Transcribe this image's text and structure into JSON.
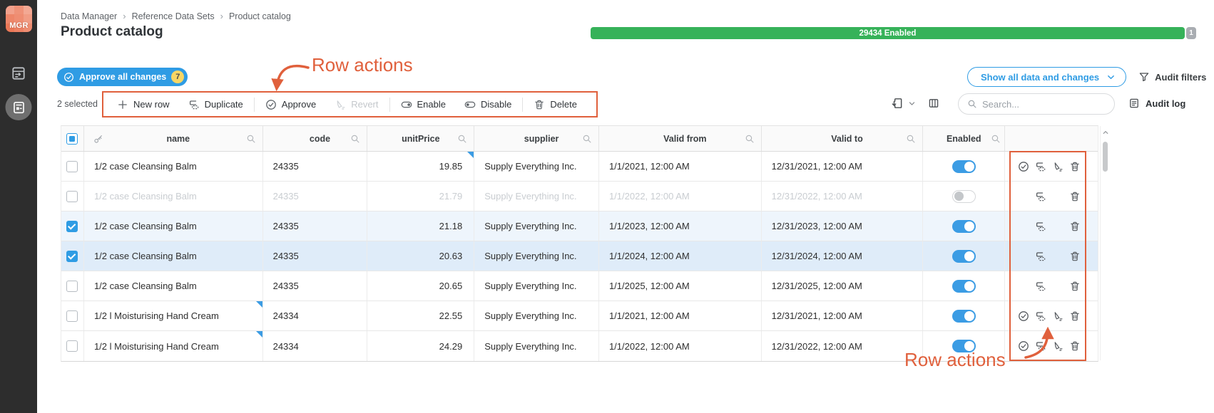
{
  "app": {
    "logo_text": "MGR"
  },
  "header": {
    "breadcrumb": [
      "Data Manager",
      "Reference Data Sets",
      "Product catalog"
    ],
    "title": "Product catalog",
    "status_bar": {
      "enabled_label": "29434 Enabled",
      "disabled_label": "1",
      "enabled_color": "#36b259"
    }
  },
  "actions_bar": {
    "approve_all_label": "Approve all changes",
    "approve_all_badge": "7",
    "show_all_label": "Show all data and changes",
    "audit_filters_label": "Audit filters"
  },
  "toolbar": {
    "selected_count": "2 selected",
    "new_row": "New row",
    "duplicate": "Duplicate",
    "approve": "Approve",
    "revert": "Revert",
    "enable": "Enable",
    "disable": "Disable",
    "delete": "Delete",
    "search_placeholder": "Search...",
    "audit_log_label": "Audit log"
  },
  "annotations": {
    "row_actions_top": "Row actions",
    "row_actions_bottom": "Row actions",
    "color": "#e0603c"
  },
  "table": {
    "columns": [
      "name",
      "code",
      "unitPrice",
      "supplier",
      "Valid from",
      "Valid to",
      "Enabled"
    ],
    "rows": [
      {
        "name": "1/2 case Cleansing Balm",
        "code": "24335",
        "unitPrice": "19.85",
        "supplier": "Supply Everything Inc.",
        "valid_from": "1/1/2021, 12:00 AM",
        "valid_to": "12/31/2021, 12:00 AM",
        "enabled": true,
        "state": "normal",
        "changed": "unitPrice",
        "actions": [
          "approve",
          "duplicate",
          "revert",
          "delete"
        ]
      },
      {
        "name": "1/2 case Cleansing Balm",
        "code": "24335",
        "unitPrice": "21.79",
        "supplier": "Supply Everything Inc.",
        "valid_from": "1/1/2022, 12:00 AM",
        "valid_to": "12/31/2022, 12:00 AM",
        "enabled": false,
        "state": "disabled",
        "changed": null,
        "actions": [
          "duplicate",
          "delete"
        ]
      },
      {
        "name": "1/2 case Cleansing Balm",
        "code": "24335",
        "unitPrice": "21.18",
        "supplier": "Supply Everything Inc.",
        "valid_from": "1/1/2023, 12:00 AM",
        "valid_to": "12/31/2023, 12:00 AM",
        "enabled": true,
        "state": "selected",
        "changed": null,
        "actions": [
          "duplicate",
          "delete"
        ]
      },
      {
        "name": "1/2 case Cleansing Balm",
        "code": "24335",
        "unitPrice": "20.63",
        "supplier": "Supply Everything Inc.",
        "valid_from": "1/1/2024, 12:00 AM",
        "valid_to": "12/31/2024, 12:00 AM",
        "enabled": true,
        "state": "selected-active",
        "changed": null,
        "actions": [
          "duplicate",
          "delete"
        ]
      },
      {
        "name": "1/2 case Cleansing Balm",
        "code": "24335",
        "unitPrice": "20.65",
        "supplier": "Supply Everything Inc.",
        "valid_from": "1/1/2025, 12:00 AM",
        "valid_to": "12/31/2025, 12:00 AM",
        "enabled": true,
        "state": "normal",
        "changed": null,
        "actions": [
          "duplicate",
          "delete"
        ]
      },
      {
        "name": "1/2 l Moisturising Hand Cream",
        "code": "24334",
        "unitPrice": "22.55",
        "supplier": "Supply Everything Inc.",
        "valid_from": "1/1/2021, 12:00 AM",
        "valid_to": "12/31/2021, 12:00 AM",
        "enabled": true,
        "state": "normal",
        "changed": "name",
        "actions": [
          "approve",
          "duplicate",
          "revert",
          "delete"
        ]
      },
      {
        "name": "1/2 l Moisturising Hand Cream",
        "code": "24334",
        "unitPrice": "24.29",
        "supplier": "Supply Everything Inc.",
        "valid_from": "1/1/2022, 12:00 AM",
        "valid_to": "12/31/2022, 12:00 AM",
        "enabled": true,
        "state": "normal",
        "changed": "name",
        "actions": [
          "approve",
          "duplicate",
          "revert",
          "delete"
        ]
      }
    ]
  }
}
